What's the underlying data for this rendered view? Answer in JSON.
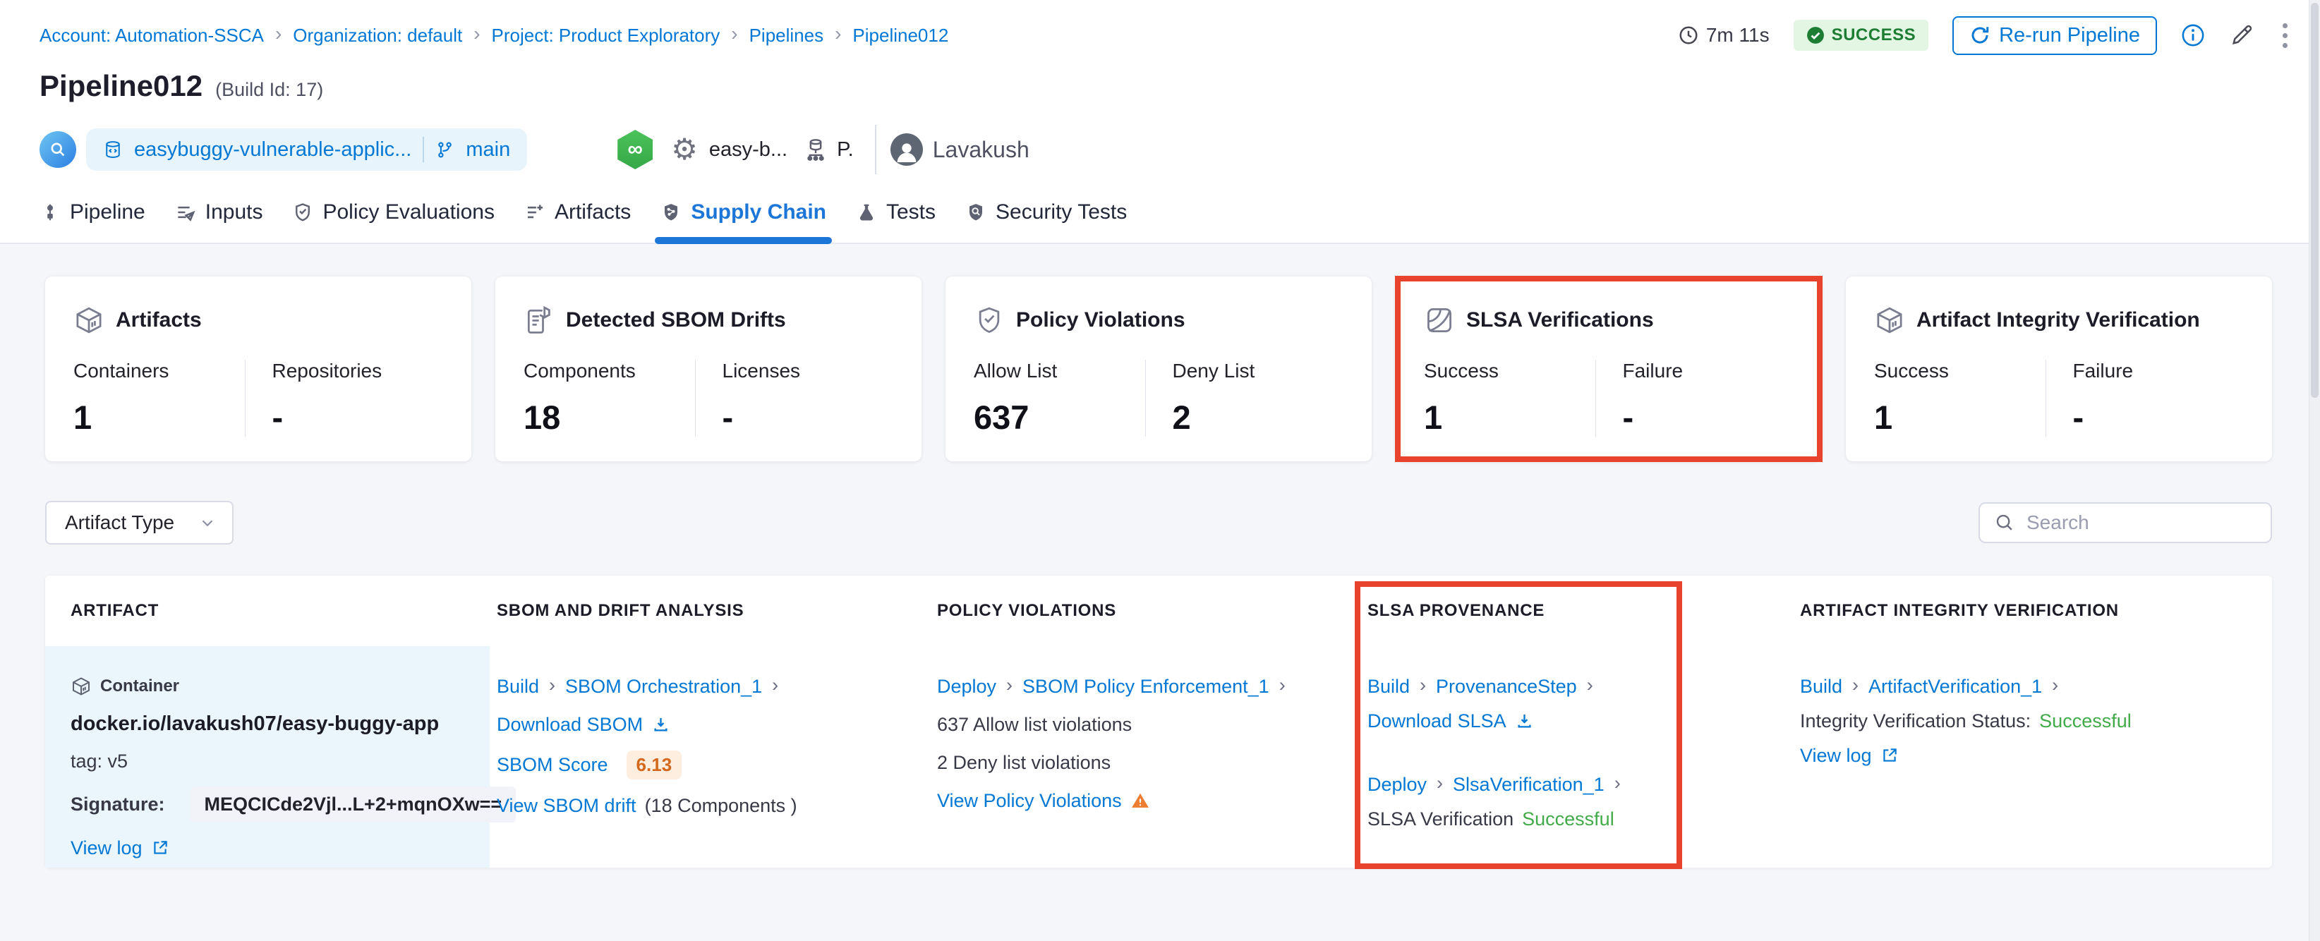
{
  "colors": {
    "accent_blue": "#0278d5",
    "active_tab_blue": "#1b76d8",
    "success_green_badge": "#1c7d33",
    "success_green_text": "#42ab49",
    "highlight_red": "#e8432c",
    "score_orange": "#d4691e",
    "warning_orange": "#ed7d31"
  },
  "breadcrumb": {
    "items": [
      "Account: Automation-SSCA",
      "Organization: default",
      "Project: Product Exploratory",
      "Pipelines",
      "Pipeline012"
    ]
  },
  "header": {
    "title": "Pipeline012",
    "build_id": "(Build Id: 17)",
    "duration": "7m 11s",
    "status": "SUCCESS",
    "rerun_label": "Re-run Pipeline",
    "repo": "easybuggy-vulnerable-applic...",
    "branch": "main",
    "infinity_glyph": "∞",
    "webhook_text": "easy-b...",
    "delegate_short": "P.",
    "user": "Lavakush"
  },
  "tabs": [
    {
      "label": "Pipeline"
    },
    {
      "label": "Inputs"
    },
    {
      "label": "Policy Evaluations"
    },
    {
      "label": "Artifacts"
    },
    {
      "label": "Supply Chain"
    },
    {
      "label": "Tests"
    },
    {
      "label": "Security Tests"
    }
  ],
  "cards": [
    {
      "title": "Artifacts",
      "col1_label": "Containers",
      "col1_value": "1",
      "col2_label": "Repositories",
      "col2_value": "-"
    },
    {
      "title": "Detected SBOM Drifts",
      "col1_label": "Components",
      "col1_value": "18",
      "col2_label": "Licenses",
      "col2_value": "-"
    },
    {
      "title": "Policy Violations",
      "col1_label": "Allow List",
      "col1_value": "637",
      "col2_label": "Deny List",
      "col2_value": "2"
    },
    {
      "title": "SLSA Verifications",
      "col1_label": "Success",
      "col1_value": "1",
      "col2_label": "Failure",
      "col2_value": "-"
    },
    {
      "title": "Artifact Integrity Verification",
      "col1_label": "Success",
      "col1_value": "1",
      "col2_label": "Failure",
      "col2_value": "-"
    }
  ],
  "filters": {
    "artifact_type_label": "Artifact Type",
    "search_placeholder": "Search"
  },
  "table": {
    "headers": [
      "ARTIFACT",
      "SBOM AND DRIFT ANALYSIS",
      "POLICY VIOLATIONS",
      "SLSA PROVENANCE",
      "ARTIFACT INTEGRITY VERIFICATION"
    ],
    "row": {
      "artifact": {
        "type_label": "Container",
        "name": "docker.io/lavakush07/easy-buggy-app",
        "tag": "tag: v5",
        "signature_label": "Signature:",
        "signature_value": "MEQCICde2Vjl...L+2+mqnOXw==",
        "view_log": "View log"
      },
      "sbom": {
        "stage": "Build",
        "step": "SBOM Orchestration_1",
        "download": "Download SBOM",
        "score_label": "SBOM Score",
        "score_value": "6.13",
        "drift_link": "View SBOM drift",
        "drift_suffix": "(18 Components )"
      },
      "policy": {
        "stage": "Deploy",
        "step": "SBOM Policy Enforcement_1",
        "allow": "637 Allow list violations",
        "deny": "2 Deny list violations",
        "view": "View Policy Violations"
      },
      "slsa": {
        "stage1": "Build",
        "step1": "ProvenanceStep",
        "download": "Download SLSA",
        "stage2": "Deploy",
        "step2": "SlsaVerification_1",
        "status_label": "SLSA Verification",
        "status_value": "Successful"
      },
      "integrity": {
        "stage": "Build",
        "step": "ArtifactVerification_1",
        "status_label": "Integrity Verification Status:",
        "status_value": "Successful",
        "view_log": "View log"
      }
    }
  }
}
